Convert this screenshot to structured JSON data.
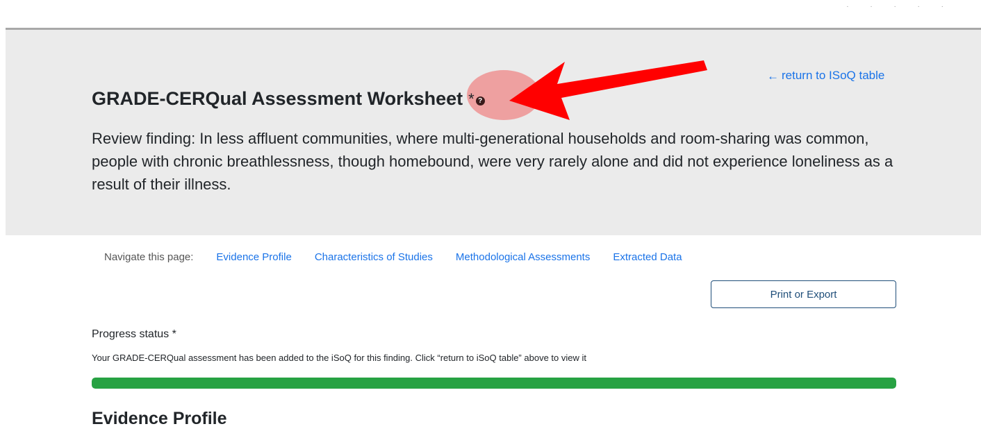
{
  "header": {
    "return_link": "return to ISoQ table",
    "title": "GRADE-CERQual Assessment Worksheet",
    "title_asterisk": "*",
    "help_glyph": "?",
    "finding": "Review finding: In less affluent communities, where multi-generational households and room-sharing was common, people with chronic breathlessness, though homebound, were very rarely alone and did not experience loneliness as a result of their illness."
  },
  "nav": {
    "label": "Navigate this page:",
    "links": [
      "Evidence Profile",
      "Characteristics of Studies",
      "Methodological Assessments",
      "Extracted Data"
    ]
  },
  "actions": {
    "print_label": "Print or Export"
  },
  "progress": {
    "label": "Progress status *",
    "message": "Your GRADE-CERQual assessment has been added to the iSoQ for this finding. Click “return to iSoQ table” above to view it",
    "percent": 100,
    "color": "#27a243"
  },
  "section": {
    "heading": "Evidence Profile"
  },
  "icons": {
    "return": "arrow-left-icon",
    "help": "question-circle-icon",
    "annotation": "red-arrow-annotation"
  }
}
